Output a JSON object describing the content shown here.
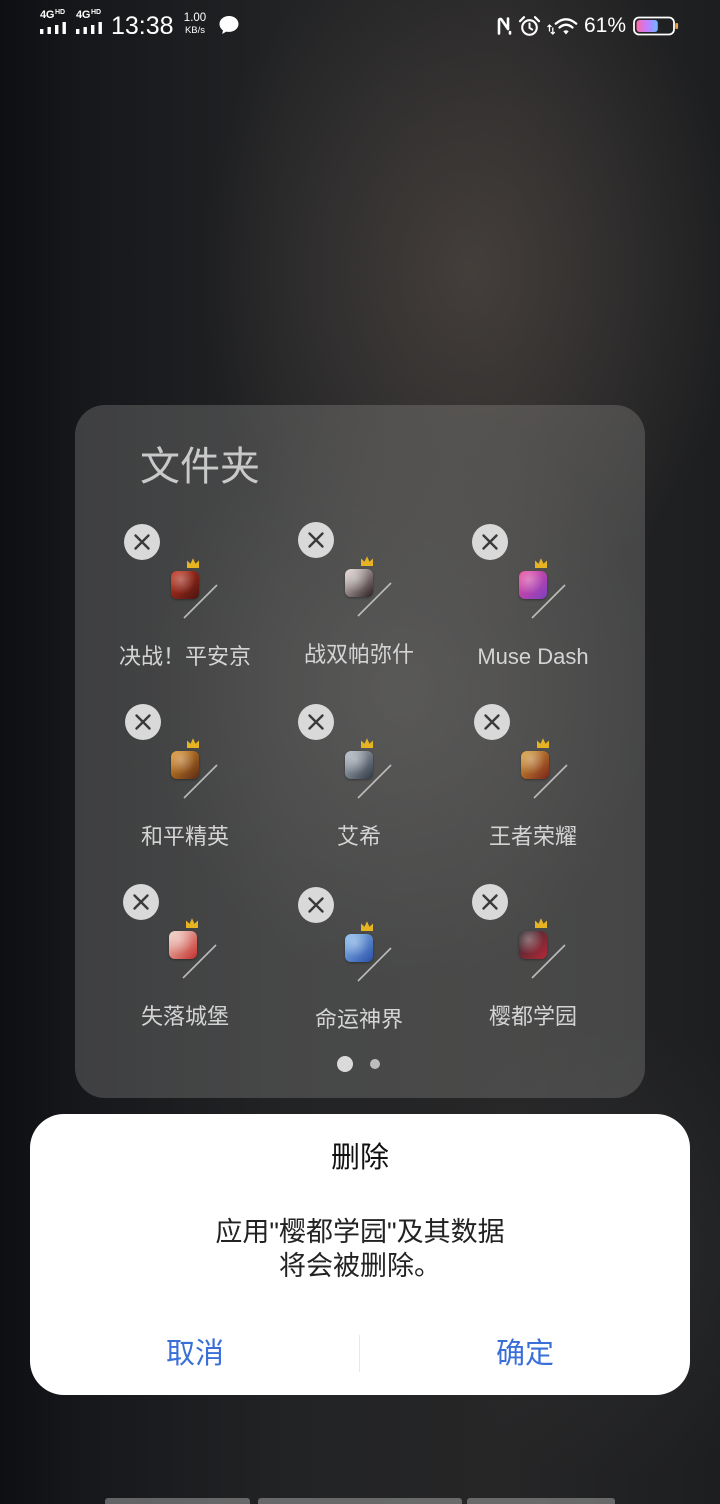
{
  "status_bar": {
    "sim1": {
      "network": "4G",
      "badge": "HD",
      "icon": "signal-bars-icon"
    },
    "sim2": {
      "network": "4G",
      "badge": "HD",
      "icon": "signal-bars-icon"
    },
    "time": "13:38",
    "speed_value": "1.00",
    "speed_unit": "KB/s",
    "notification_icon": "chat-bubble-icon",
    "right_icons": [
      "nfc-icon",
      "alarm-icon",
      "wifi-icon",
      "battery-icon"
    ],
    "battery_percent": "61%",
    "battery_level": 0.61
  },
  "folder": {
    "title": "文件夹",
    "apps": [
      {
        "label": "决战！平安京",
        "icon": "juezhan-pinganjing-app-icon",
        "icon_colors": [
          "#c8341f",
          "#4a1410"
        ]
      },
      {
        "label": "战双帕弥什",
        "icon": "zhanshuang-pamishi-app-icon",
        "icon_colors": [
          "#e9dedc",
          "#2b1d20"
        ]
      },
      {
        "label": "Muse Dash",
        "icon": "muse-dash-app-icon",
        "icon_colors": [
          "#f04a9c",
          "#7c3fc0"
        ]
      },
      {
        "label": "和平精英",
        "icon": "heping-jingying-app-icon",
        "icon_colors": [
          "#e3962c",
          "#5a2a14"
        ]
      },
      {
        "label": "艾希",
        "icon": "aixi-app-icon",
        "icon_colors": [
          "#b8c2cc",
          "#2e3742"
        ]
      },
      {
        "label": "王者荣耀",
        "icon": "wangzhe-rongyao-app-icon",
        "icon_colors": [
          "#d9a43a",
          "#7a2418"
        ]
      },
      {
        "label": "失落城堡",
        "icon": "shiluo-chengbao-app-icon",
        "icon_colors": [
          "#f2d8cc",
          "#c42e2a"
        ]
      },
      {
        "label": "命运神界",
        "icon": "mingyun-shenjie-app-icon",
        "icon_colors": [
          "#8cc0f0",
          "#2a4fa8"
        ]
      },
      {
        "label": "樱都学园",
        "icon": "yingdu-xueyuan-app-icon",
        "icon_colors": [
          "#2a2a30",
          "#b82838"
        ]
      }
    ],
    "app_badges": [
      "delete-badge-close-icon",
      "crown-icon"
    ],
    "page_indicator": {
      "total": 2,
      "current": 1
    }
  },
  "dialog": {
    "title": "删除",
    "message_lines": [
      "应用\"樱都学园\"及其数据",
      "将会被删除。"
    ],
    "cancel_label": "取消",
    "confirm_label": "确定"
  },
  "colors": {
    "accent": "#3a6fd8",
    "dialog_bg": "#ffffff",
    "badge_bg": "#d9d9d9",
    "label": "#d4d4d4",
    "title": "#c9c9c9",
    "crown": "#e6b422"
  }
}
